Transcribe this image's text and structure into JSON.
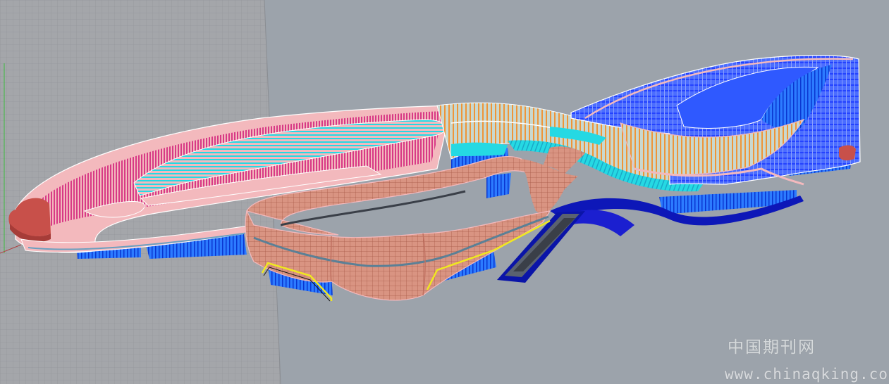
{
  "viewport": {
    "background_color": "#9ca3ab",
    "ground_plane_color": "#a4a6aa",
    "grid_line_color": "#8d9096",
    "axis_colors": {
      "y": "#3dbb3d",
      "x": "#b04040"
    }
  },
  "model": {
    "colors": {
      "pink_shell": "#f3b9bd",
      "magenta_fins": "#d83a86",
      "cyan_glazing": "#25d9e3",
      "salmon_podium": "#d99482",
      "red_cap": "#c8504a",
      "orange_fins": "#ee9538",
      "blue_facade": "#2f59ff",
      "blue_floors": "#1f62ff",
      "deep_blue_ramp": "#0d17b8",
      "yellow_edge": "#f0e820",
      "dark_slab": "#3a3f48"
    }
  },
  "watermark": {
    "site_name": "中国期刊网",
    "url": "www.chinaqking.com"
  }
}
